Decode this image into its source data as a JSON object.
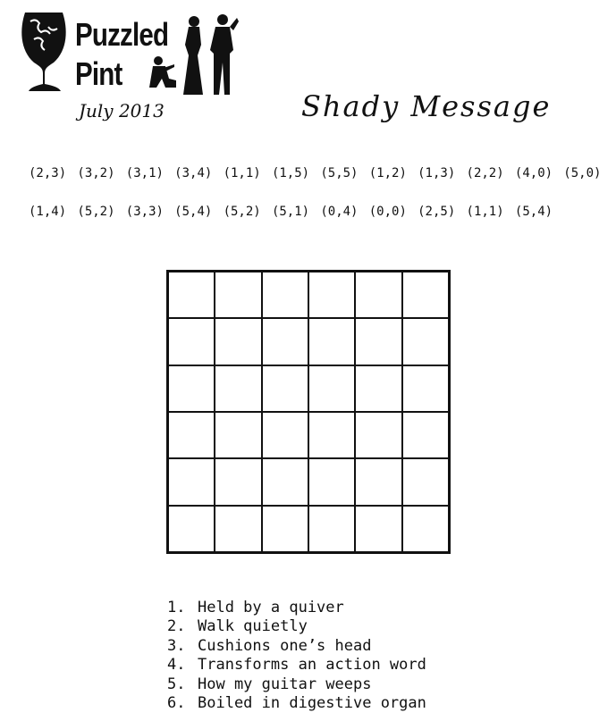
{
  "header": {
    "logo_line1": "Puzzled",
    "logo_line2": "Pint",
    "date": "July 2013",
    "title": "Shady Message"
  },
  "coordinates": {
    "row1": [
      "(2,3)",
      "(3,2)",
      "(3,1)",
      "(3,4)",
      "(1,1)",
      "(1,5)",
      "(5,5)",
      "(1,2)",
      "(1,3)",
      "(2,2)",
      "(4,0)",
      "(5,0)"
    ],
    "row2": [
      "(1,4)",
      "(5,2)",
      "(3,3)",
      "(5,4)",
      "(5,2)",
      "(5,1)",
      "(0,4)",
      "(0,0)",
      "(2,5)",
      "(1,1)",
      "(5,4)"
    ]
  },
  "grid": {
    "rows": 6,
    "cols": 6
  },
  "clues": [
    {
      "num": "1.",
      "text": "Held by a quiver"
    },
    {
      "num": "2.",
      "text": "Walk quietly"
    },
    {
      "num": "3.",
      "text": "Cushions one’s head"
    },
    {
      "num": "4.",
      "text": "Transforms an action word"
    },
    {
      "num": "5.",
      "text": "How my guitar weeps"
    },
    {
      "num": "6.",
      "text": "Boiled in digestive organ"
    }
  ]
}
